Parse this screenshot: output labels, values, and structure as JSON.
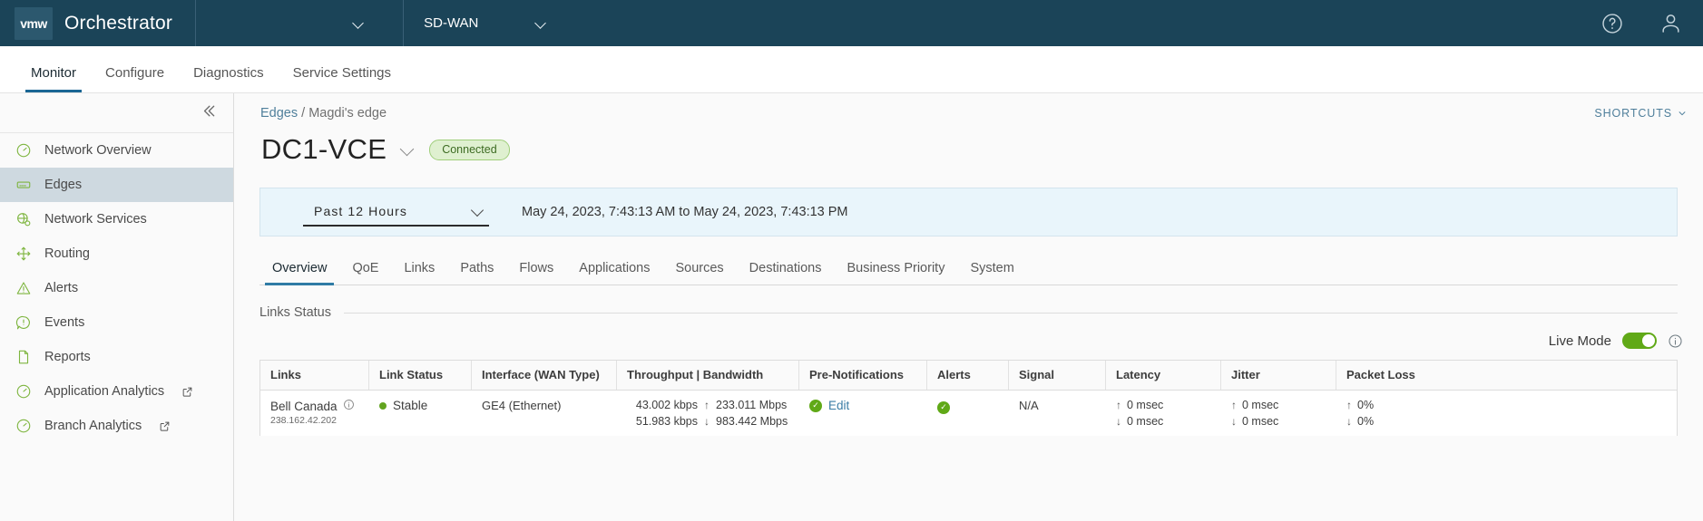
{
  "header": {
    "logo_text": "vmw",
    "app_title": "Orchestrator",
    "customer_select": {
      "value": "",
      "icon": "chevron-down-icon"
    },
    "product_select": {
      "value": "SD-WAN",
      "icon": "chevron-down-icon"
    },
    "help_icon": "help-circle-icon",
    "user_icon": "user-avatar-icon"
  },
  "nav_tabs": [
    {
      "label": "Monitor",
      "active": true
    },
    {
      "label": "Configure",
      "active": false
    },
    {
      "label": "Diagnostics",
      "active": false
    },
    {
      "label": "Service Settings",
      "active": false
    }
  ],
  "sidebar": {
    "collapse_icon": "double-chevron-left-icon",
    "items": [
      {
        "label": "Network Overview",
        "icon": "gauge-icon",
        "active": false,
        "external": false
      },
      {
        "label": "Edges",
        "icon": "edge-device-icon",
        "active": true,
        "external": false
      },
      {
        "label": "Network Services",
        "icon": "network-services-icon",
        "active": false,
        "external": false
      },
      {
        "label": "Routing",
        "icon": "routing-icon",
        "active": false,
        "external": false
      },
      {
        "label": "Alerts",
        "icon": "warning-triangle-icon",
        "active": false,
        "external": false
      },
      {
        "label": "Events",
        "icon": "exclamation-bubble-icon",
        "active": false,
        "external": false
      },
      {
        "label": "Reports",
        "icon": "document-icon",
        "active": false,
        "external": false
      },
      {
        "label": "Application Analytics",
        "icon": "gauge-icon",
        "active": false,
        "external": true
      },
      {
        "label": "Branch Analytics",
        "icon": "gauge-icon",
        "active": false,
        "external": true
      }
    ]
  },
  "content": {
    "breadcrumb": {
      "parent": "Edges",
      "separator": "/",
      "current": "Magdi's edge"
    },
    "shortcuts": {
      "label": "SHORTCUTS",
      "icon": "chevron-down-icon"
    },
    "page_title": "DC1-VCE",
    "title_dropdown_icon": "chevron-down-icon",
    "status_badge": "Connected",
    "time_selector": {
      "value": "Past 12 Hours",
      "icon": "chevron-down-icon",
      "range_text": "May 24, 2023, 7:43:13 AM to May 24, 2023, 7:43:13 PM"
    },
    "sub_tabs": [
      {
        "label": "Overview",
        "active": true
      },
      {
        "label": "QoE",
        "active": false
      },
      {
        "label": "Links",
        "active": false
      },
      {
        "label": "Paths",
        "active": false
      },
      {
        "label": "Flows",
        "active": false
      },
      {
        "label": "Applications",
        "active": false
      },
      {
        "label": "Sources",
        "active": false
      },
      {
        "label": "Destinations",
        "active": false
      },
      {
        "label": "Business Priority",
        "active": false
      },
      {
        "label": "System",
        "active": false
      }
    ],
    "section_title": "Links Status",
    "live_mode": {
      "label": "Live Mode",
      "enabled": true,
      "info_icon": "info-circle-icon"
    },
    "table": {
      "columns": [
        "Links",
        "Link Status",
        "Interface (WAN Type)",
        "Throughput | Bandwidth",
        "Pre-Notifications",
        "Alerts",
        "Signal",
        "Latency",
        "Jitter",
        "Packet Loss"
      ],
      "rows": [
        {
          "link_name": "Bell Canada",
          "link_info_icon": "info-circle-icon",
          "link_ip": "238.162.42.202",
          "link_status": "Stable",
          "link_status_color": "#62a420",
          "interface": "GE4 (Ethernet)",
          "throughput_up": "43.002 kbps",
          "bandwidth_up": "233.011 Mbps",
          "throughput_down": "51.983 kbps",
          "bandwidth_down": "983.442 Mbps",
          "pre_notifications": "Edit",
          "pre_notifications_icon": "check-circle-icon",
          "alerts_icon": "check-circle-icon",
          "signal": "N/A",
          "latency_up": "0 msec",
          "latency_down": "0 msec",
          "jitter_up": "0 msec",
          "jitter_down": "0 msec",
          "loss_up": "0%",
          "loss_down": "0%"
        }
      ]
    }
  },
  "colors": {
    "header_bg": "#1b4458",
    "accent_blue": "#2f7ba5",
    "status_green": "#60a917",
    "link_blue": "#4f7f9b"
  }
}
